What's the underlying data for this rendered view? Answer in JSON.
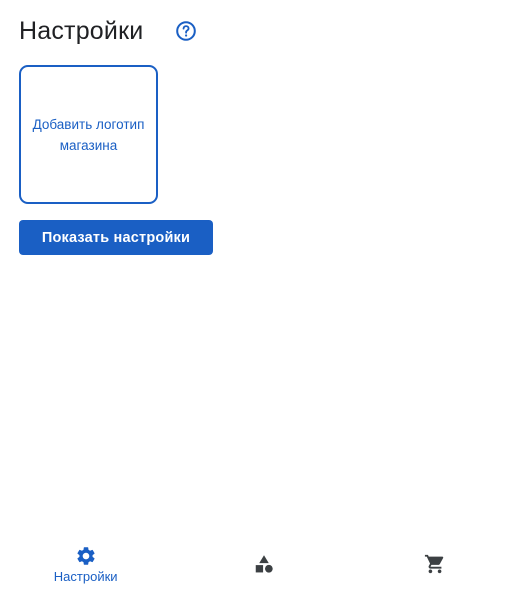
{
  "header": {
    "title": "Настройки",
    "help_icon": "help-circle-icon"
  },
  "logo_upload": {
    "label": "Добавить логотип магазина"
  },
  "actions": {
    "show_settings_label": "Показать настройки"
  },
  "bottom_nav": {
    "items": [
      {
        "icon": "gear-icon",
        "label": "Настройки",
        "active": true
      },
      {
        "icon": "shapes-icon",
        "label": "",
        "active": false
      },
      {
        "icon": "cart-icon",
        "label": "",
        "active": false
      }
    ]
  },
  "colors": {
    "accent": "#1a5fc4",
    "text": "#202124",
    "icon_inactive": "#3c4043",
    "background": "#ffffff"
  }
}
